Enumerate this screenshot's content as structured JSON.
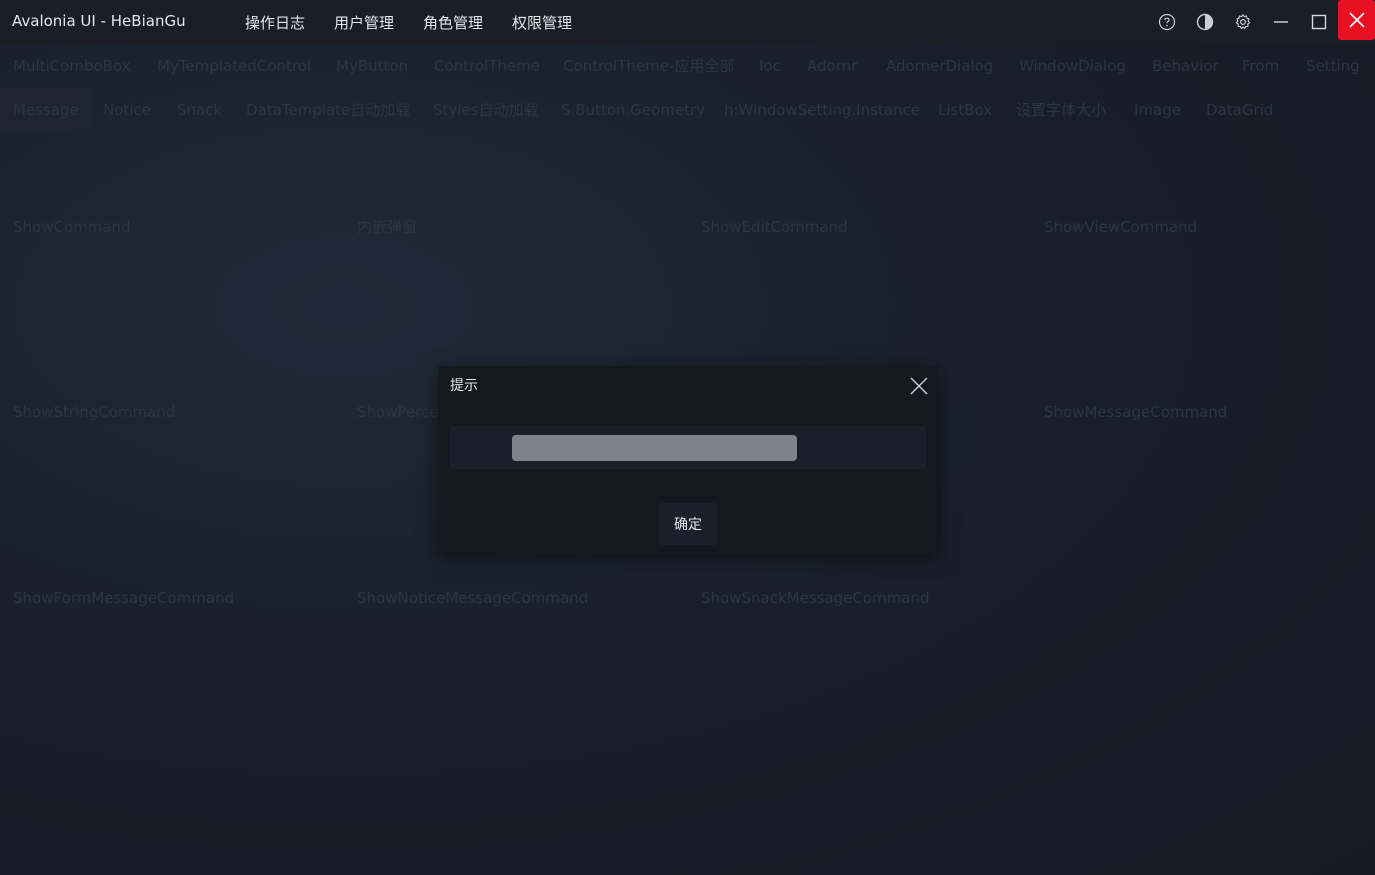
{
  "window": {
    "title": "Avalonia UI - HeBianGu"
  },
  "top_menu": [
    "操作日志",
    "用户管理",
    "角色管理",
    "权限管理"
  ],
  "title_icons": [
    "help-icon",
    "theme-icon",
    "settings-icon",
    "minimize-icon",
    "maximize-icon",
    "close-icon"
  ],
  "tabs_row1": [
    "MultiComboBox",
    "MyTemplatedControl",
    "MyButton",
    "ControlTheme",
    "ControlTheme-应用全部",
    "Ioc",
    "Adornr",
    "AdornerDialog",
    "WindowDialog",
    "Behavior",
    "From",
    "Setting"
  ],
  "tabs_row2": [
    "Message",
    "Notice",
    "Snack",
    "DataTemplate自动加载",
    "Styles自动加载",
    "S.Button.Geometry",
    "h:WindowSetting.Instance",
    "ListBox",
    "设置字体大小",
    "Image",
    "DataGrid"
  ],
  "active_tab": "Message",
  "commands": {
    "r1": [
      "ShowCommand",
      "内嵌弹窗",
      "ShowEditCommand",
      "ShowViewCommand"
    ],
    "r2": [
      "ShowStringCommand",
      "ShowPerce",
      "ShowMessageCommand"
    ],
    "r3": [
      "ShowFormMessageCommand",
      "ShowNoticeMessageCommand",
      "ShowSnackMessageCommand"
    ]
  },
  "dialog": {
    "title": "提示",
    "ok_label": "确定"
  },
  "colors": {
    "close_button": "#e81123",
    "titlebar": "#1a1f27",
    "dialog": "#141920"
  }
}
